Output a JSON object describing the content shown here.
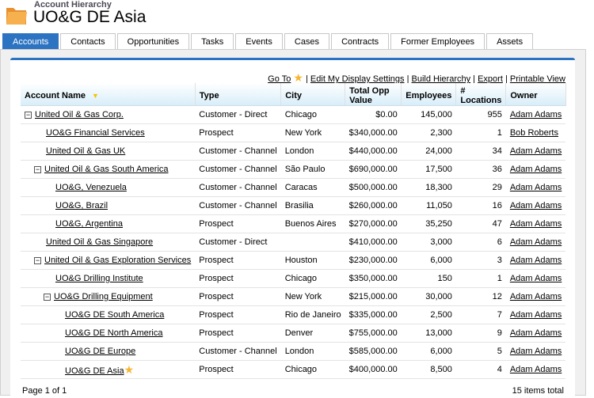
{
  "header": {
    "subtitle": "Account Hierarchy",
    "title": "UO&G DE Asia"
  },
  "tabs": [
    "Accounts",
    "Contacts",
    "Opportunities",
    "Tasks",
    "Events",
    "Cases",
    "Contracts",
    "Former Employees",
    "Assets"
  ],
  "links": {
    "goto": "Go To",
    "edit": "Edit My Display Settings",
    "build": "Build Hierarchy",
    "export": "Export",
    "print": "Printable View"
  },
  "columns": [
    "Account Name",
    "Type",
    "City",
    "Total Opp Value",
    "Employees",
    "# Locations",
    "Owner"
  ],
  "rows": [
    {
      "level": 0,
      "toggle": true,
      "name": "United Oil & Gas Corp.",
      "type": "Customer - Direct",
      "city": "Chicago",
      "opp": "$0.00",
      "emp": "145,000",
      "loc": "955",
      "owner": "Adam Adams"
    },
    {
      "level": 1,
      "toggle": false,
      "name": "UO&G Financial Services",
      "type": "Prospect",
      "city": "New York",
      "opp": "$340,000.00",
      "emp": "2,300",
      "loc": "1",
      "owner": "Bob Roberts"
    },
    {
      "level": 1,
      "toggle": false,
      "name": "United Oil & Gas UK",
      "type": "Customer - Channel",
      "city": "London",
      "opp": "$440,000.00",
      "emp": "24,000",
      "loc": "34",
      "owner": "Adam Adams"
    },
    {
      "level": 1,
      "toggle": true,
      "name": "United Oil & Gas South America",
      "type": "Customer - Channel",
      "city": "São Paulo",
      "opp": "$690,000.00",
      "emp": "17,500",
      "loc": "36",
      "owner": "Adam Adams"
    },
    {
      "level": 2,
      "toggle": false,
      "name": "UO&G, Venezuela",
      "type": "Customer - Channel",
      "city": "Caracas",
      "opp": "$500,000.00",
      "emp": "18,300",
      "loc": "29",
      "owner": "Adam Adams"
    },
    {
      "level": 2,
      "toggle": false,
      "name": "UO&G, Brazil",
      "type": "Customer - Channel",
      "city": "Brasilia",
      "opp": "$260,000.00",
      "emp": "11,050",
      "loc": "16",
      "owner": "Adam Adams"
    },
    {
      "level": 2,
      "toggle": false,
      "name": "UO&G, Argentina",
      "type": "Prospect",
      "city": "Buenos Aires",
      "opp": "$270,000.00",
      "emp": "35,250",
      "loc": "47",
      "owner": "Adam Adams"
    },
    {
      "level": 1,
      "toggle": false,
      "name": "United Oil & Gas Singapore",
      "type": "Customer - Direct",
      "city": "",
      "opp": "$410,000.00",
      "emp": "3,000",
      "loc": "6",
      "owner": "Adam Adams"
    },
    {
      "level": 1,
      "toggle": true,
      "name": "United Oil & Gas Exploration Services",
      "type": "Prospect",
      "city": "Houston",
      "opp": "$230,000.00",
      "emp": "6,000",
      "loc": "3",
      "owner": "Adam Adams"
    },
    {
      "level": 2,
      "toggle": false,
      "name": "UO&G Drilling Institute",
      "type": "Prospect",
      "city": "Chicago",
      "opp": "$350,000.00",
      "emp": "150",
      "loc": "1",
      "owner": "Adam Adams"
    },
    {
      "level": 2,
      "toggle": true,
      "name": "UO&G Drilling Equipment",
      "type": "Prospect",
      "city": "New York",
      "opp": "$215,000.00",
      "emp": "30,000",
      "loc": "12",
      "owner": "Adam Adams"
    },
    {
      "level": 3,
      "toggle": false,
      "name": "UO&G DE South America",
      "type": "Prospect",
      "city": "Rio de Janeiro",
      "opp": "$335,000.00",
      "emp": "2,500",
      "loc": "7",
      "owner": "Adam Adams"
    },
    {
      "level": 3,
      "toggle": false,
      "name": "UO&G DE North America",
      "type": "Prospect",
      "city": "Denver",
      "opp": "$755,000.00",
      "emp": "13,000",
      "loc": "9",
      "owner": "Adam Adams"
    },
    {
      "level": 3,
      "toggle": false,
      "name": "UO&G DE Europe",
      "type": "Customer - Channel",
      "city": "London",
      "opp": "$585,000.00",
      "emp": "6,000",
      "loc": "5",
      "owner": "Adam Adams"
    },
    {
      "level": 3,
      "toggle": false,
      "current": true,
      "name": "UO&G DE Asia",
      "type": "Prospect",
      "city": "Chicago",
      "opp": "$400,000.00",
      "emp": "8,500",
      "loc": "4",
      "owner": "Adam Adams"
    }
  ],
  "footer": {
    "page": "Page 1 of 1",
    "total": "15 items total"
  },
  "colors": {
    "accent": "#2c73c2",
    "star": "#f5b632"
  }
}
